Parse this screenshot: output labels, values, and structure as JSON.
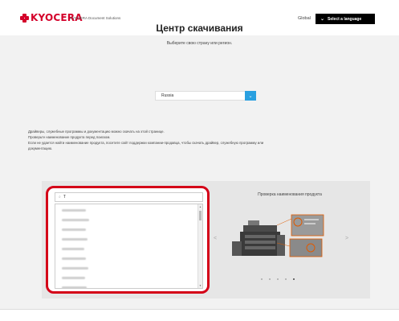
{
  "header": {
    "logo_text": "KYOCERA",
    "logo_sub": "KYOCERA Document Solutions",
    "global_label": "Global",
    "language_button": "Select a language"
  },
  "hero": {
    "title": "Центр скачивания",
    "subtitle": "Выберите свою страну или регион.",
    "region_value": "Russia"
  },
  "info_lines": [
    "Драйверы, служебные программы и документацию можно скачать на этой странице.",
    "Проверьте наименование продукта перед поиском.",
    "Если не удается найти наименование продукта, посетите сайт поддержки компании-продавца, чтобы скачать драйвер, служебную программу или",
    "документацию."
  ],
  "search": {
    "value": "T",
    "result_count_visible": 10
  },
  "carousel": {
    "title": "Проверка наименования продукта",
    "dots_total": 5,
    "active_dot": 5
  },
  "colors": {
    "brand": "#d4002a",
    "accent": "#2aa0e0",
    "highlight_border": "#d40018"
  }
}
